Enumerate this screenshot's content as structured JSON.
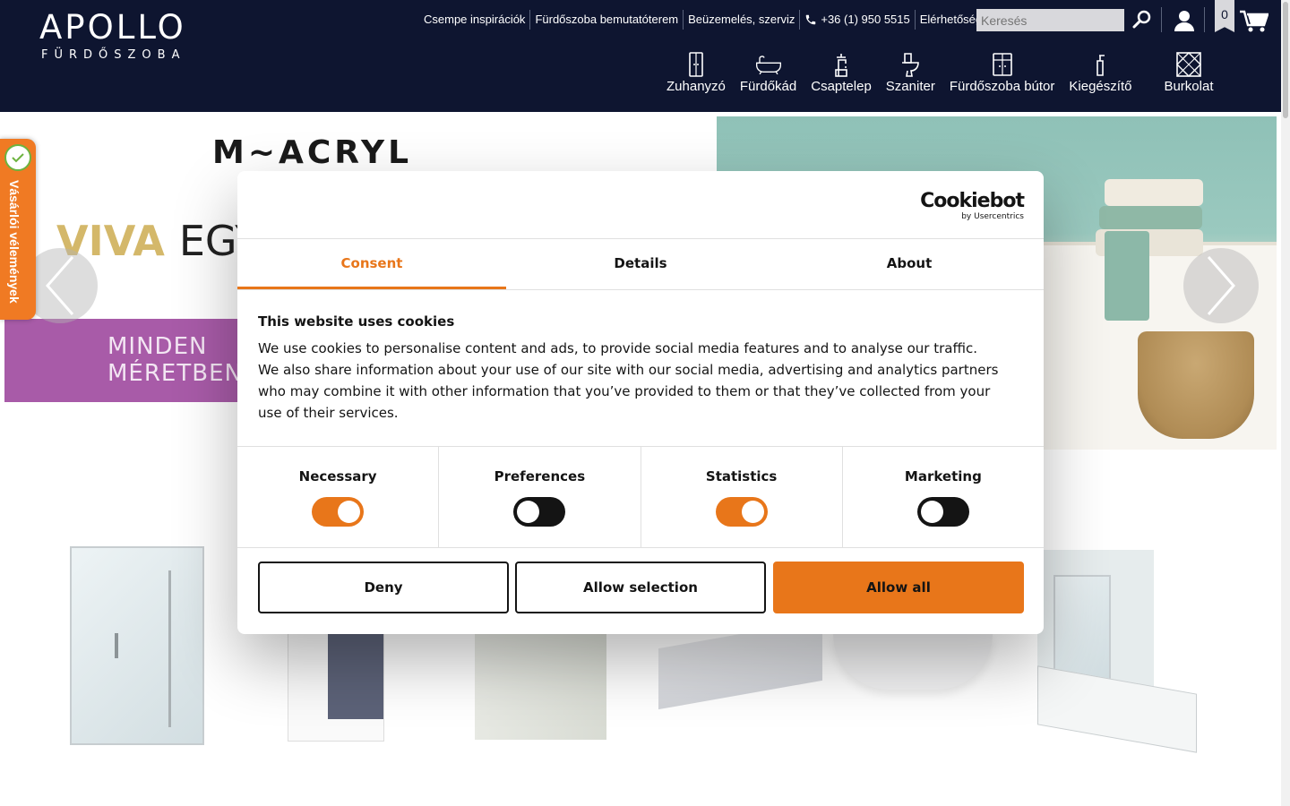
{
  "logo": {
    "main": "APOLLO",
    "sub": "FÜRDŐSZOBA"
  },
  "toplinks": [
    "Csempe inspirációk",
    "Fürdőszoba bemutatóterem",
    "Beüzemelés, szerviz",
    "+36 (1) 950 5515",
    "Elérhetőségek"
  ],
  "search": {
    "placeholder": "Keresés"
  },
  "wishlist_count": "0",
  "nav": [
    "Zuhanyzó",
    "Fürdőkád",
    "Csaptelep",
    "Szaniter",
    "Fürdőszoba bútor",
    "Kiegészítő",
    "Burkolat"
  ],
  "banner": {
    "brand": "M~ACRYL",
    "headline_a": "VIVA",
    "headline_b": "EGY",
    "purple_line1": "MINDEN",
    "purple_line2": "MÉRETBEN"
  },
  "review_tab": "Vásárlói vélemények",
  "cookie": {
    "logo_main": "Cookiebot",
    "logo_sub": "by Usercentrics",
    "tabs": [
      "Consent",
      "Details",
      "About"
    ],
    "active_tab": "Consent",
    "title": "This website uses cookies",
    "body": "We use cookies to personalise content and ads, to provide social media features and to analyse our traffic. We also share information about your use of our site with our social media, advertising and analytics partners who may combine it with other information that you’ve provided to them or that they’ve collected from your use of their services.",
    "toggles": [
      {
        "label": "Necessary",
        "state": "on"
      },
      {
        "label": "Preferences",
        "state": "off"
      },
      {
        "label": "Statistics",
        "state": "on"
      },
      {
        "label": "Marketing",
        "state": "off"
      }
    ],
    "buttons": {
      "deny": "Deny",
      "selection": "Allow selection",
      "all": "Allow all"
    }
  },
  "colors": {
    "header_bg": "#0e1530",
    "accent": "#e8761a",
    "review_tab": "#f07a23",
    "purple": "#a85ba8"
  }
}
